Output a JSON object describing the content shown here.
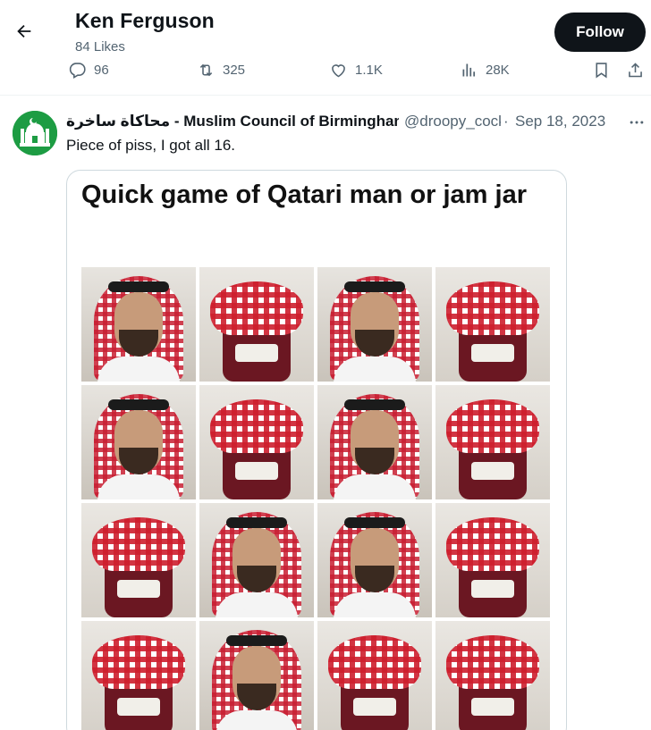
{
  "header": {
    "name": "Ken Ferguson",
    "likes": "84 Likes",
    "follow_label": "Follow"
  },
  "actions": {
    "replies": "96",
    "reposts": "325",
    "likes": "1.1K",
    "views": "28K"
  },
  "tweet": {
    "author": "محاكاة ساخرة - Muslim Council of Birmingham",
    "handle": "@droopy_cock",
    "separator": "·",
    "date": "Sep 18, 2023",
    "text": "Piece of piss, I got all 16."
  },
  "media": {
    "title": "Quick game of Qatari man or jam jar",
    "tiles": [
      "man",
      "jar",
      "man",
      "jar",
      "man",
      "jar",
      "man",
      "jar",
      "jar",
      "man",
      "man",
      "jar",
      "jar",
      "man",
      "jar",
      "jar"
    ]
  },
  "icons": {
    "back": "arrow-left-icon",
    "reply": "comment-icon",
    "repost": "retweet-icon",
    "like": "heart-icon",
    "views": "bar-chart-icon",
    "bookmark": "bookmark-icon",
    "share": "share-icon",
    "more": "ellipsis-icon"
  },
  "colors": {
    "text": "#0f1419",
    "muted": "#536471",
    "follow_bg": "#0f1419",
    "avatar_bg": "#1d9c43"
  }
}
